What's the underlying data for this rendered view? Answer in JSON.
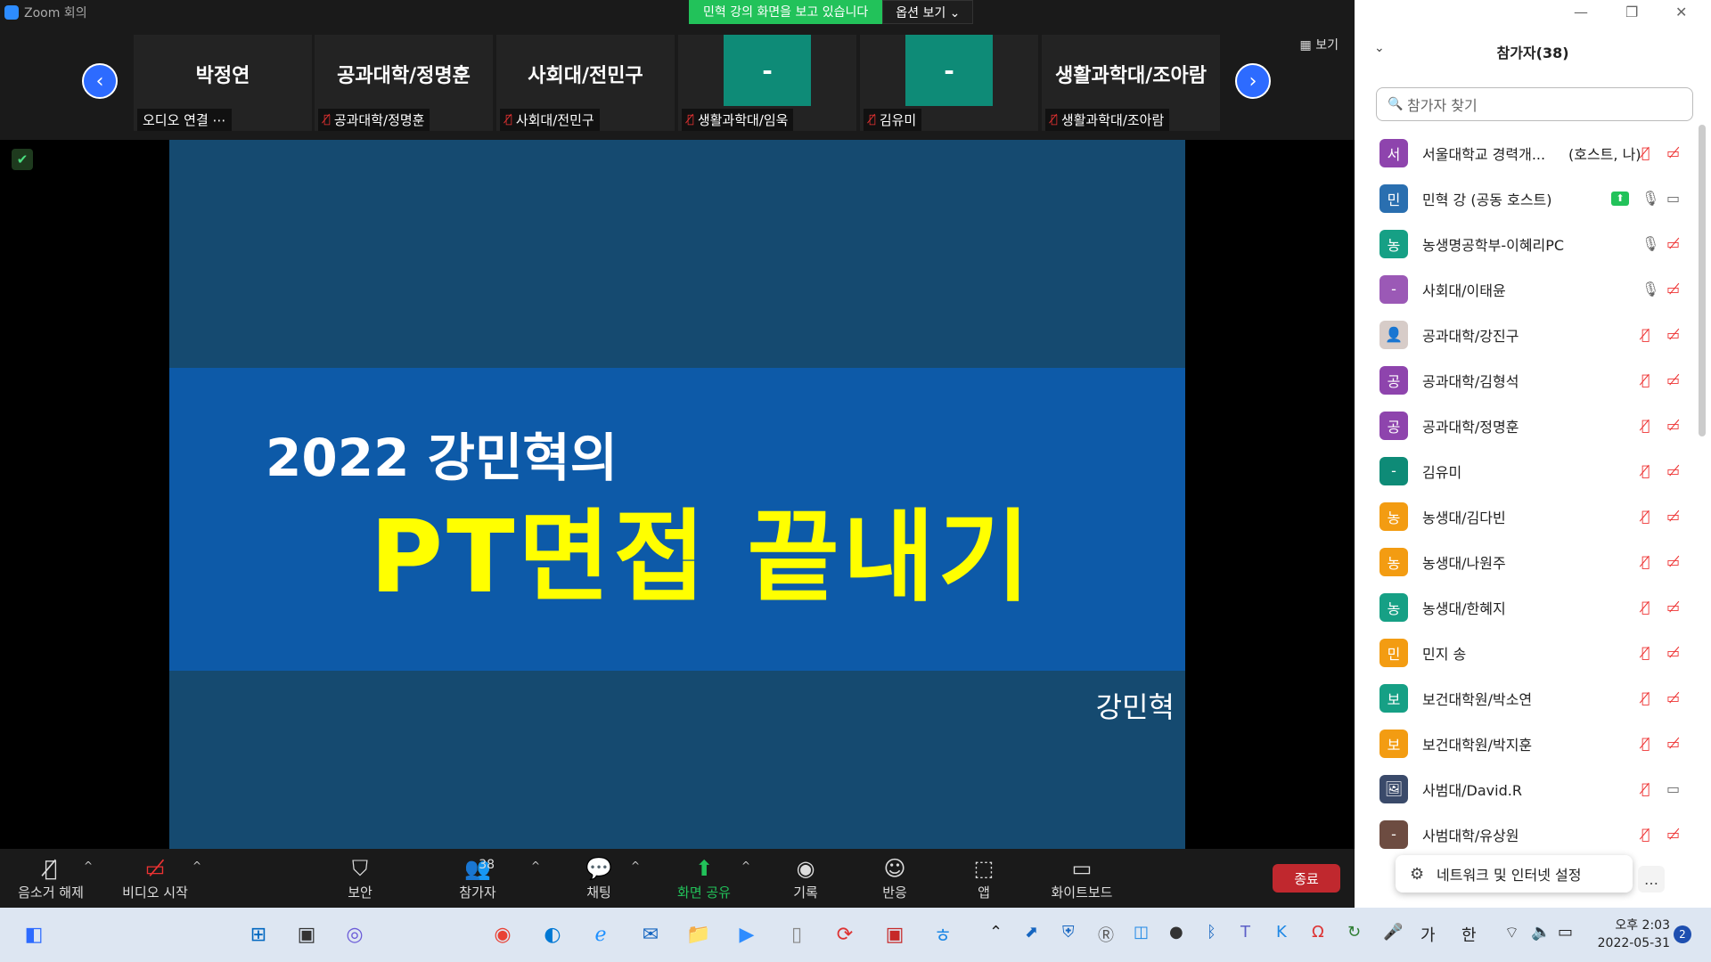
{
  "window": {
    "title": "Zoom 회의",
    "share_banner": "민혁 강의 화면을 보고 있습니다",
    "options_label": "옵션 보기 ⌄"
  },
  "strip": {
    "view_label": "▦ 보기",
    "thumbs": [
      {
        "big": "박정연",
        "label": "오디오 연결 ⋯"
      },
      {
        "big": "공과대학/정명훈",
        "label": "공과대학/정명훈"
      },
      {
        "big": "사회대/전민구",
        "label": "사회대/전민구"
      },
      {
        "big": "-",
        "label": "생활과학대/임욱"
      },
      {
        "big": "-",
        "label": "김유미"
      },
      {
        "big": "생활과학대/조아람",
        "label": "생활과학대/조아람"
      }
    ]
  },
  "slide": {
    "subtitle": "2022 강민혁의",
    "title": "PT면접 끝내기",
    "author": "강민혁",
    "colors": {
      "bg": "#154a70",
      "band": "#0d5aa8",
      "title": "#ffff00"
    }
  },
  "toolbar": {
    "unmute": "음소거 해제",
    "video": "비디오 시작",
    "security": "보안",
    "participants": "참가자",
    "participants_count": "38",
    "chat": "채팅",
    "share": "화면 공유",
    "record": "기록",
    "reactions": "반응",
    "apps": "앱",
    "whiteboard": "화이트보드",
    "end": "종료"
  },
  "panel": {
    "title": "참가자(38)",
    "search_placeholder": "참가자 찾기",
    "participants": [
      {
        "avatar": "서",
        "color": "#8e44ad",
        "name": "서울대학교 경력개...",
        "badge": "(호스트, 나)",
        "mic": "muted",
        "video": "off"
      },
      {
        "avatar": "민",
        "color": "#2a6fb0",
        "name": "민혁 강 (공동 호스트)",
        "badge": "",
        "mic": "on",
        "video": "on",
        "sharing": true
      },
      {
        "avatar": "농",
        "color": "#16a085",
        "name": "농생명공학부-이혜리PC",
        "badge": "",
        "mic": "on",
        "video": "off"
      },
      {
        "avatar": "-",
        "color": "#9b59b6",
        "name": "사회대/이태윤",
        "badge": "",
        "mic": "on",
        "video": "off"
      },
      {
        "avatar": "👤",
        "color": "#d7ccc8",
        "name": "공과대학/강진구",
        "badge": "",
        "mic": "muted",
        "video": "off"
      },
      {
        "avatar": "공",
        "color": "#8e44ad",
        "name": "공과대학/김형석",
        "badge": "",
        "mic": "muted",
        "video": "off"
      },
      {
        "avatar": "공",
        "color": "#8e44ad",
        "name": "공과대학/정명훈",
        "badge": "",
        "mic": "muted",
        "video": "off"
      },
      {
        "avatar": "-",
        "color": "#0e8b77",
        "name": "김유미",
        "badge": "",
        "mic": "muted",
        "video": "off"
      },
      {
        "avatar": "농",
        "color": "#f39c12",
        "name": "농생대/김다빈",
        "badge": "",
        "mic": "muted",
        "video": "off"
      },
      {
        "avatar": "농",
        "color": "#f39c12",
        "name": "농생대/나원주",
        "badge": "",
        "mic": "muted",
        "video": "off"
      },
      {
        "avatar": "농",
        "color": "#16a085",
        "name": "농생대/한혜지",
        "badge": "",
        "mic": "muted",
        "video": "off"
      },
      {
        "avatar": "민",
        "color": "#f39c12",
        "name": "민지 송",
        "badge": "",
        "mic": "muted",
        "video": "off"
      },
      {
        "avatar": "보",
        "color": "#16a085",
        "name": "보건대학원/박소연",
        "badge": "",
        "mic": "muted",
        "video": "off"
      },
      {
        "avatar": "보",
        "color": "#f39c12",
        "name": "보건대학원/박지훈",
        "badge": "",
        "mic": "muted",
        "video": "off"
      },
      {
        "avatar": "🖼",
        "color": "#3a4a6a",
        "name": "사범대/David.R",
        "badge": "",
        "mic": "muted",
        "video": "on"
      },
      {
        "avatar": "-",
        "color": "#6d4c41",
        "name": "사범대학/유상원",
        "badge": "",
        "mic": "muted",
        "video": "off"
      }
    ],
    "network_tip": "네트워크 및 인터넷 설정",
    "more": "…"
  },
  "taskbar": {
    "ime": "가",
    "ime2": "한",
    "time": "오후 2:03",
    "date": "2022-05-31",
    "notifications": "2"
  }
}
